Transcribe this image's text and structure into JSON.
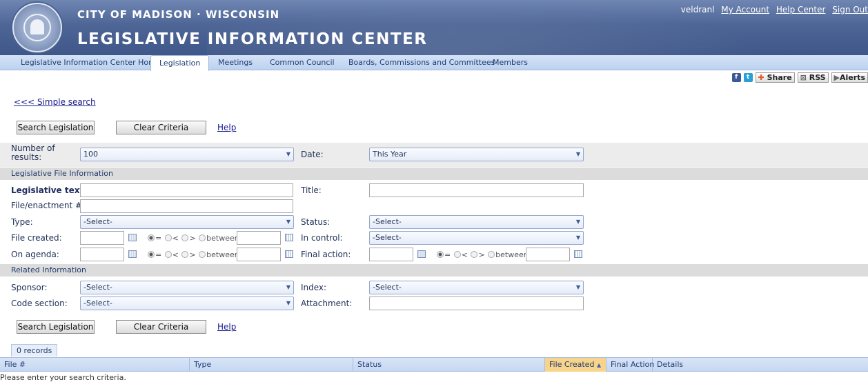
{
  "header": {
    "city": "CITY OF MADISON · WISCONSIN",
    "title": "LEGISLATIVE INFORMATION CENTER",
    "username": "veldranl",
    "links": [
      "My Account",
      "Help Center",
      "Sign Out"
    ]
  },
  "nav": {
    "tabs": [
      "Legislative Information Center Home",
      "Legislation",
      "Meetings",
      "Common Council",
      "Boards, Commissions and Committees",
      "Members"
    ],
    "active": "Legislation"
  },
  "share": {
    "share": "Share",
    "rss": "RSS",
    "alerts": "Alerts"
  },
  "simple_search": "<<< Simple search",
  "buttons": {
    "search": "Search Legislation",
    "clear": "Clear Criteria",
    "help": "Help"
  },
  "form": {
    "num_results_label": "Number of results:",
    "num_results_value": "100",
    "date_label": "Date:",
    "date_value": "This Year",
    "section_file": "Legislative File Information",
    "legislative_text_label": "Legislative text:",
    "title_label": "Title:",
    "file_label": "File/enactment #:",
    "type_label": "Type:",
    "type_value": "-Select-",
    "status_label": "Status:",
    "status_value": "-Select-",
    "file_created_label": "File created:",
    "in_control_label": "In control:",
    "in_control_value": "-Select-",
    "on_agenda_label": "On agenda:",
    "final_action_label": "Final action:",
    "radio_eq": "=",
    "radio_lt": "<",
    "radio_gt": ">",
    "radio_between": "between",
    "section_related": "Related Information",
    "sponsor_label": "Sponsor:",
    "sponsor_value": "-Select-",
    "index_label": "Index:",
    "index_value": "-Select-",
    "code_label": "Code section:",
    "code_value": "-Select-",
    "attachment_label": "Attachment:"
  },
  "results": {
    "records": "0 records",
    "columns": [
      "File #",
      "Type",
      "Status",
      "File Created",
      "Final Action",
      "Details"
    ],
    "sorted_column": "File Created",
    "empty_message": "Please enter your search criteria."
  }
}
